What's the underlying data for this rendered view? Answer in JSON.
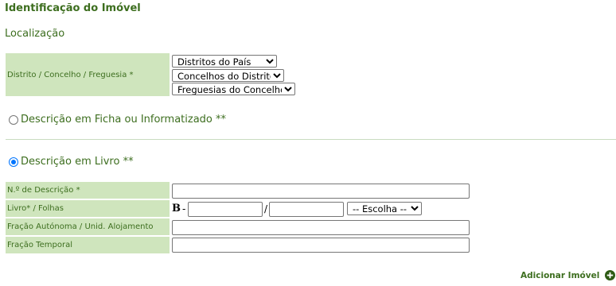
{
  "section_title": "Identificação do Imóvel",
  "location": {
    "heading": "Localização",
    "label": "Distrito / Concelho / Freguesia *",
    "district_select": "Distritos do País",
    "municipality_select": "Concelhos do Distrito",
    "parish_select": "Freguesias do Concelho"
  },
  "options": {
    "record_option": "Descrição em Ficha ou Informatizado **",
    "book_option": "Descrição em Livro **",
    "selected": "book_option"
  },
  "book_form": {
    "description_number_label": "N.º de Descrição *",
    "book_pages_label": "Livro* / Folhas",
    "book_prefix": "B",
    "dash": "-",
    "slash": "/",
    "choose_select": "-- Escolha --",
    "autonomous_fraction_label": "Fração Autónoma / Unid. Alojamento",
    "temporal_fraction_label": "Fração Temporal"
  },
  "add_property_link": "Adicionar Imóvel",
  "icons": {
    "add": "plus-circle-icon"
  }
}
